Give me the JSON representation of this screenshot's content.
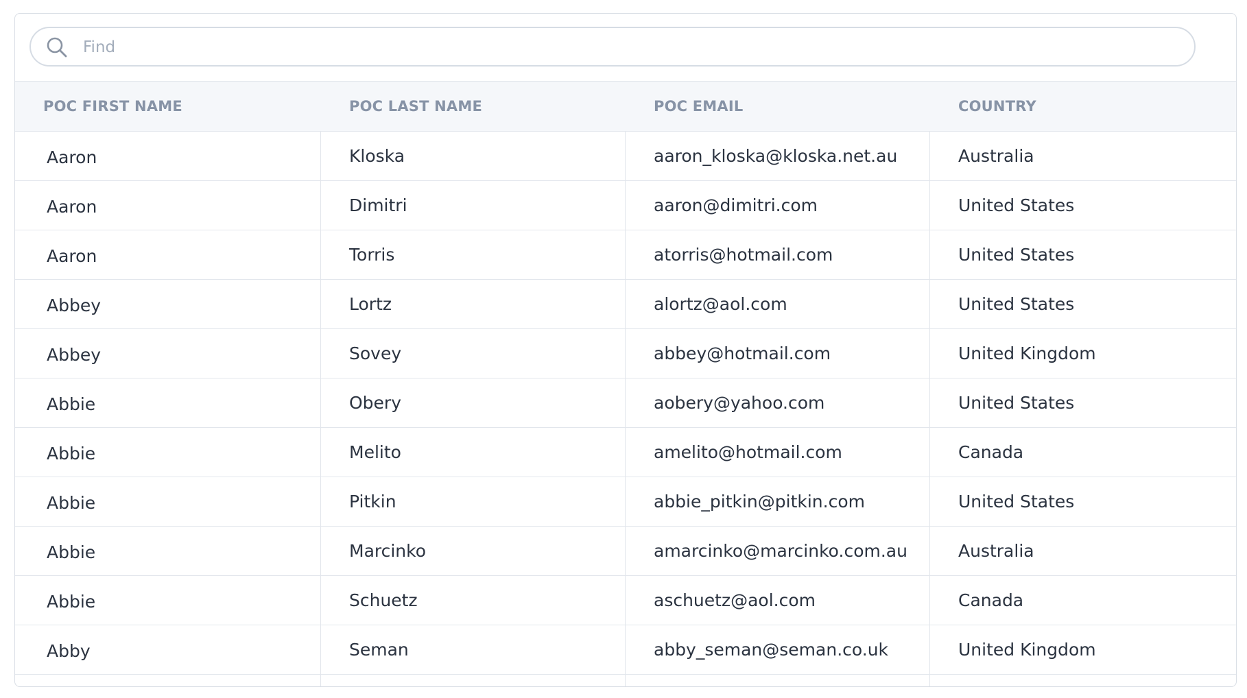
{
  "search": {
    "placeholder": "Find"
  },
  "table": {
    "columns": [
      "POC FIRST NAME",
      "POC LAST NAME",
      "POC EMAIL",
      "COUNTRY"
    ],
    "rows": [
      [
        "Aaron",
        "Kloska",
        "aaron_kloska@kloska.net.au",
        "Australia"
      ],
      [
        "Aaron",
        "Dimitri",
        "aaron@dimitri.com",
        "United States"
      ],
      [
        "Aaron",
        "Torris",
        "atorris@hotmail.com",
        "United States"
      ],
      [
        "Abbey",
        "Lortz",
        "alortz@aol.com",
        "United States"
      ],
      [
        "Abbey",
        "Sovey",
        "abbey@hotmail.com",
        "United Kingdom"
      ],
      [
        "Abbie",
        "Obery",
        "aobery@yahoo.com",
        "United States"
      ],
      [
        "Abbie",
        "Melito",
        "amelito@hotmail.com",
        "Canada"
      ],
      [
        "Abbie",
        "Pitkin",
        "abbie_pitkin@pitkin.com",
        "United States"
      ],
      [
        "Abbie",
        "Marcinko",
        "amarcinko@marcinko.com.au",
        "Australia"
      ],
      [
        "Abbie",
        "Schuetz",
        "aschuetz@aol.com",
        "Canada"
      ],
      [
        "Abby",
        "Seman",
        "abby_seman@seman.co.uk",
        "United Kingdom"
      ]
    ]
  }
}
